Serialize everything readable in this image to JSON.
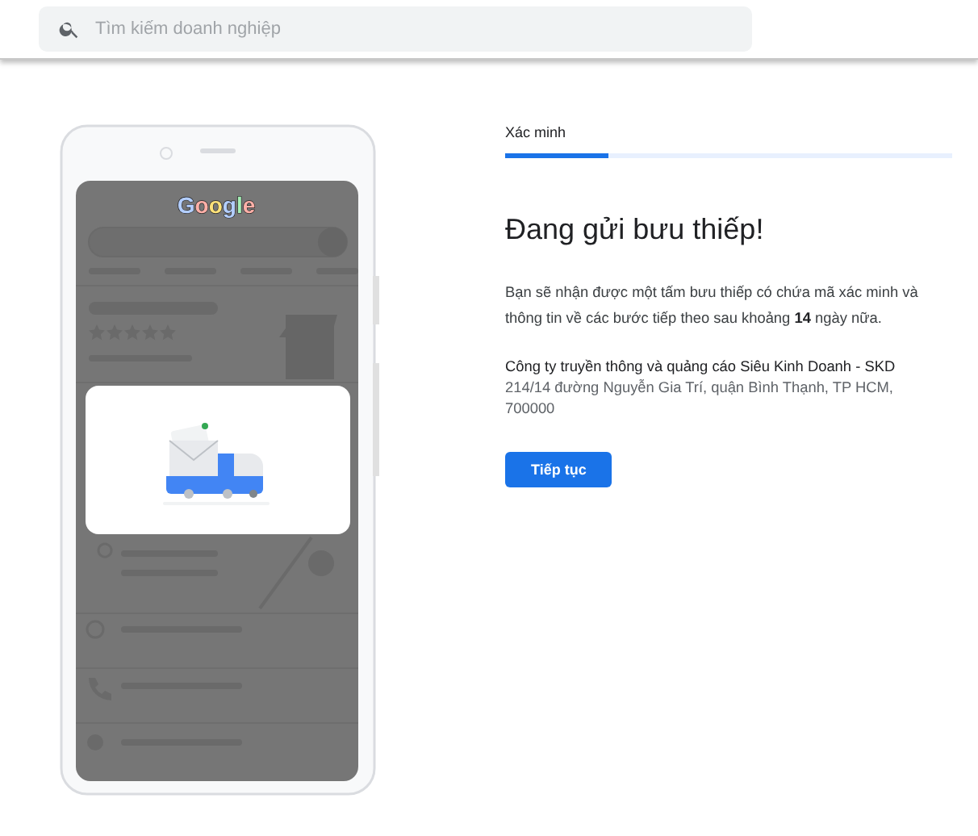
{
  "search": {
    "placeholder": "Tìm kiếm doanh nghiệp"
  },
  "illustration": {
    "logo": "Google"
  },
  "step": {
    "label": "Xác minh",
    "level": 0.23
  },
  "heading": "Đang gửi bưu thiếp!",
  "message": "Bạn sẽ nhận được một tấm bưu thiếp có chứa mã xác minh và thông tin về các bước tiếp theo sau khoảng **14** ngày nữa.",
  "business": {
    "name": "Công ty truyền thông và quảng cáo Siêu Kinh Doanh - SKD",
    "address": "214/14 đường Nguyễn Gia Trí, quận Bình Thạnh, TP HCM, 700000"
  },
  "buttons": [
    {
      "label": "Tiếp tục",
      "kind": "primary"
    }
  ]
}
